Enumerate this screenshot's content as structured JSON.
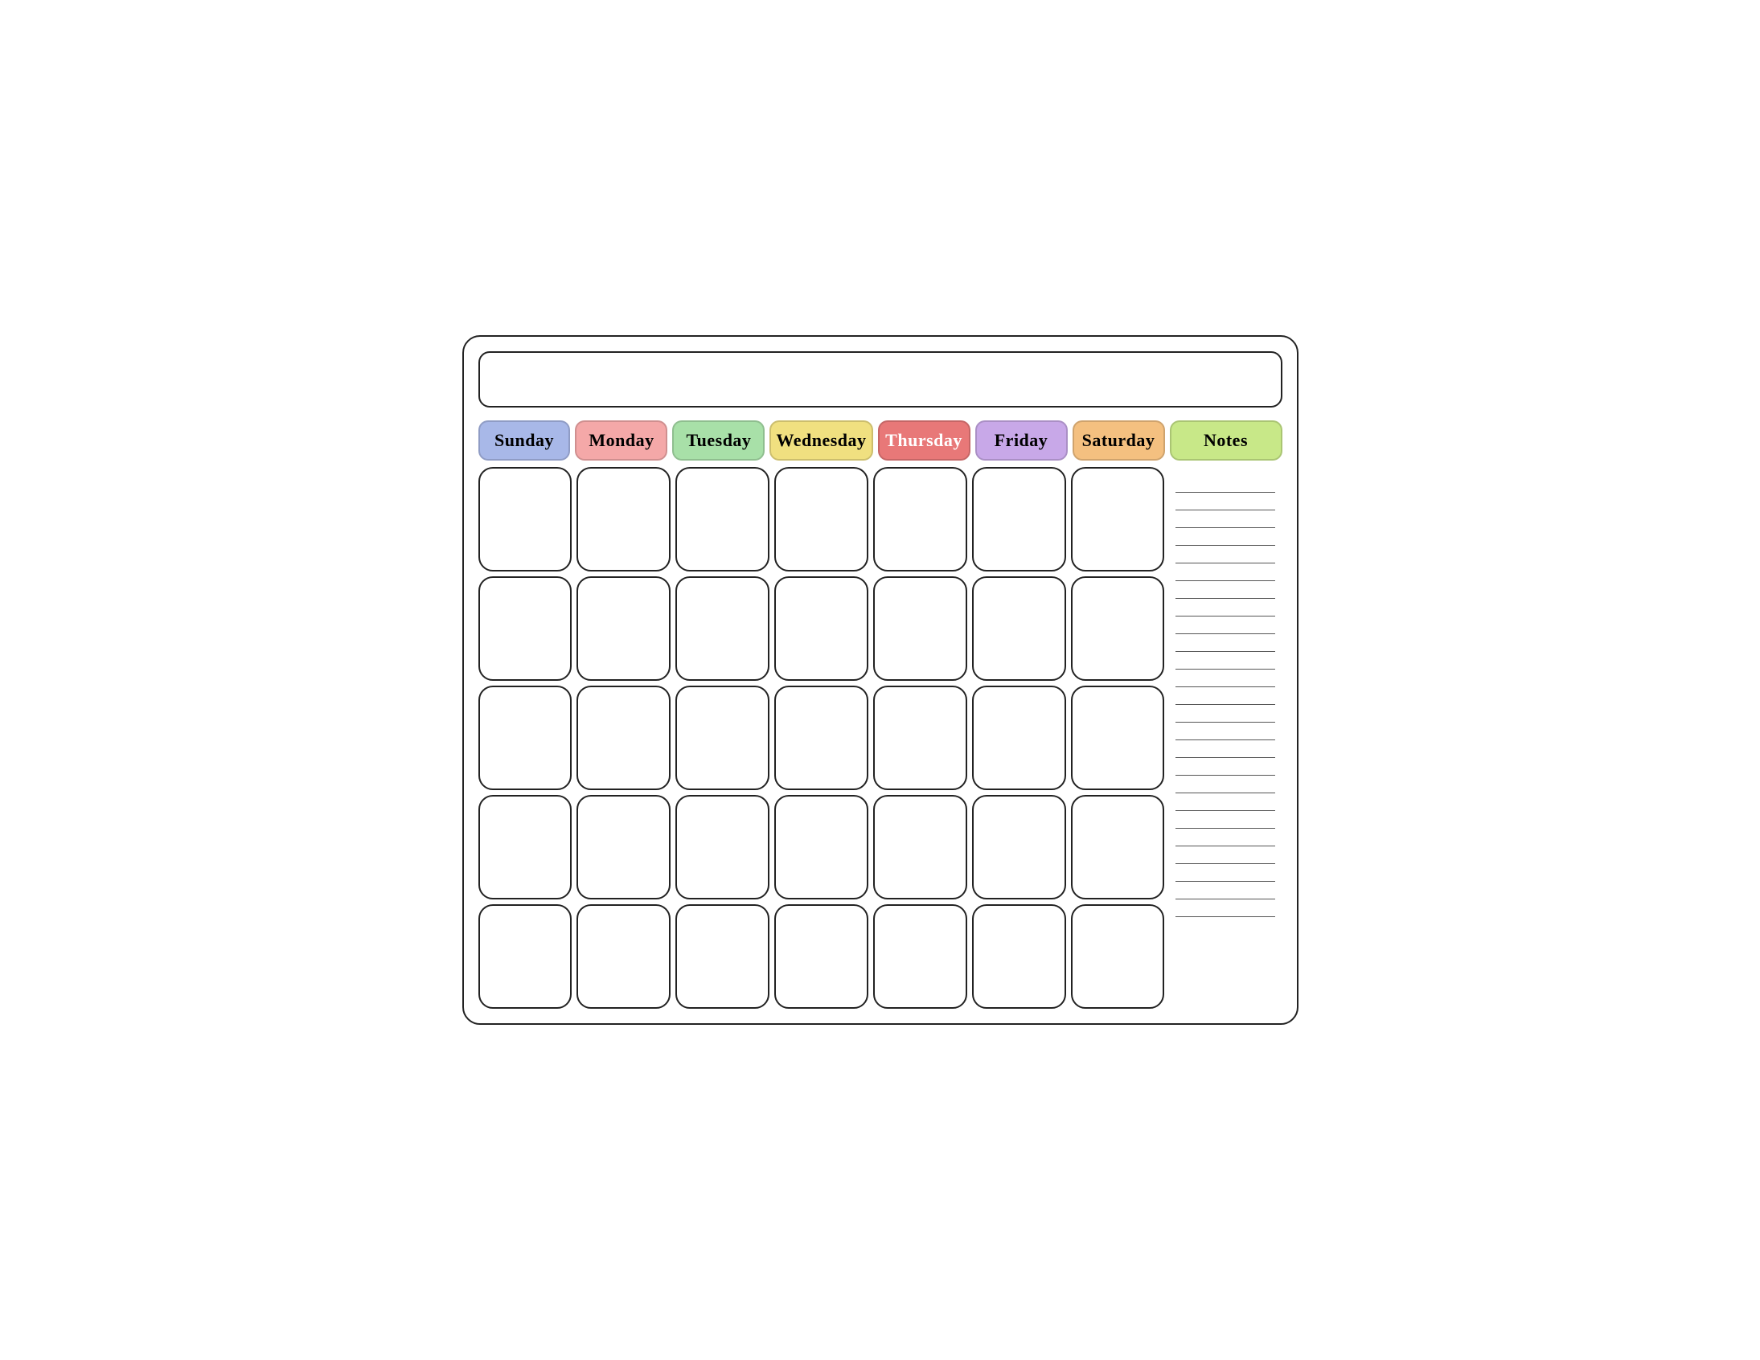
{
  "calendar": {
    "title": "",
    "days": [
      {
        "label": "Sunday",
        "class": "sunday"
      },
      {
        "label": "Monday",
        "class": "monday"
      },
      {
        "label": "Tuesday",
        "class": "tuesday"
      },
      {
        "label": "Wednesday",
        "class": "wednesday"
      },
      {
        "label": "Thursday",
        "class": "thursday"
      },
      {
        "label": "Friday",
        "class": "friday"
      },
      {
        "label": "Saturday",
        "class": "saturday"
      },
      {
        "label": "Notes",
        "class": "notes"
      }
    ],
    "rows": 5,
    "cols": 7,
    "note_lines": 25
  }
}
